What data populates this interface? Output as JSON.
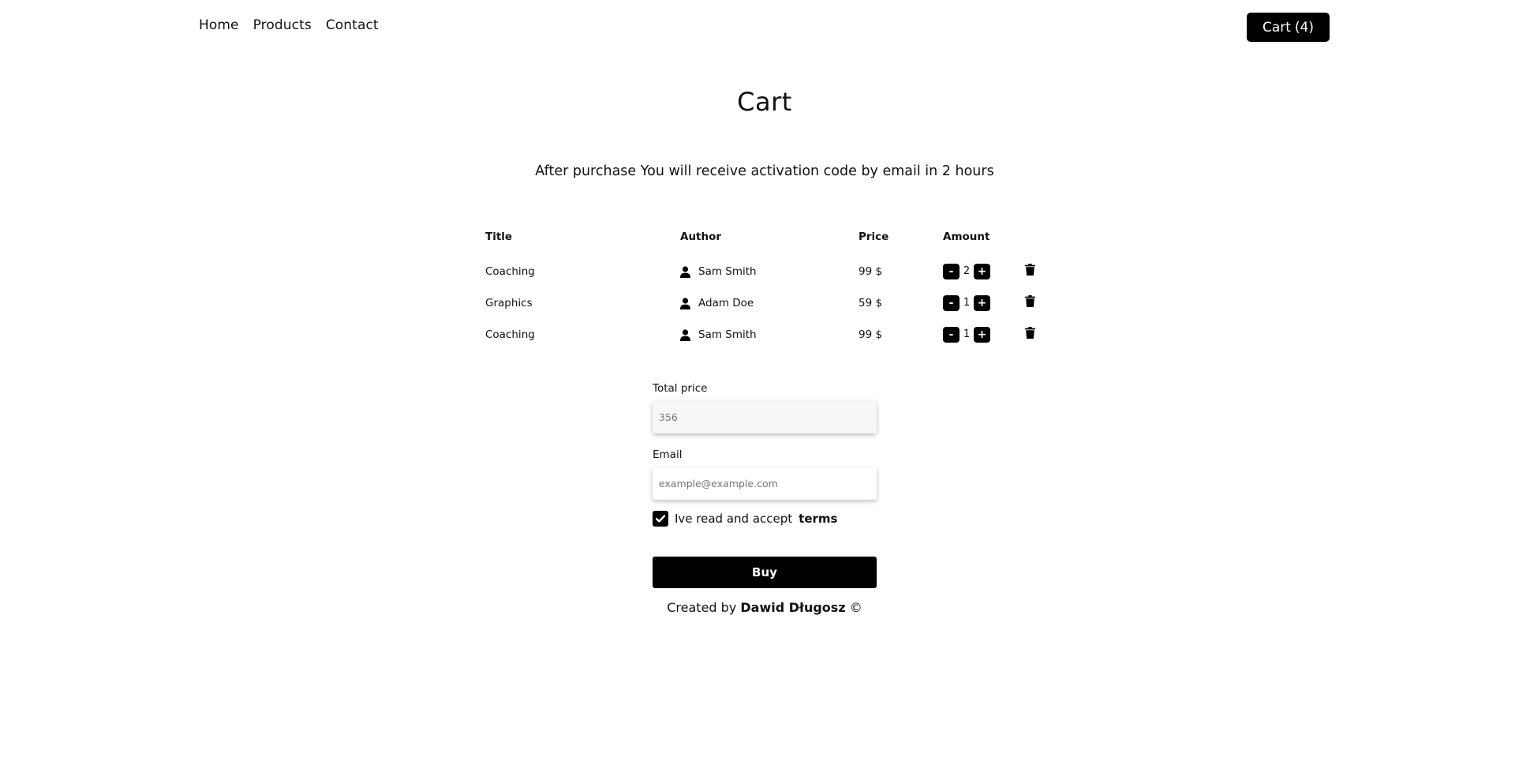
{
  "nav": {
    "links": [
      "Home",
      "Products",
      "Contact"
    ],
    "cart_label": "Cart",
    "cart_count": "(4)"
  },
  "page": {
    "title": "Cart",
    "subtitle": "After purchase You will receive activation code by email in 2 hours"
  },
  "table": {
    "headers": {
      "title": "Title",
      "author": "Author",
      "price": "Price",
      "amount": "Amount"
    },
    "rows": [
      {
        "title": "Coaching",
        "author": "Sam Smith",
        "price": "99 $",
        "amount": "2"
      },
      {
        "title": "Graphics",
        "author": "Adam Doe",
        "price": "59 $",
        "amount": "1"
      },
      {
        "title": "Coaching",
        "author": "Sam Smith",
        "price": "99 $",
        "amount": "1"
      }
    ],
    "minus_label": "-",
    "plus_label": "+",
    "icons": {
      "author": "user-icon",
      "delete": "trash-icon"
    }
  },
  "form": {
    "total_label": "Total price",
    "total_value": "356",
    "email_label": "Email",
    "email_placeholder": "example@example.com",
    "terms_text": "Ive read and accept",
    "terms_link": "terms",
    "terms_checked": true,
    "buy_label": "Buy"
  },
  "footer": {
    "prefix": "Created by",
    "author": "Dawid Długosz",
    "copyright": "©"
  }
}
